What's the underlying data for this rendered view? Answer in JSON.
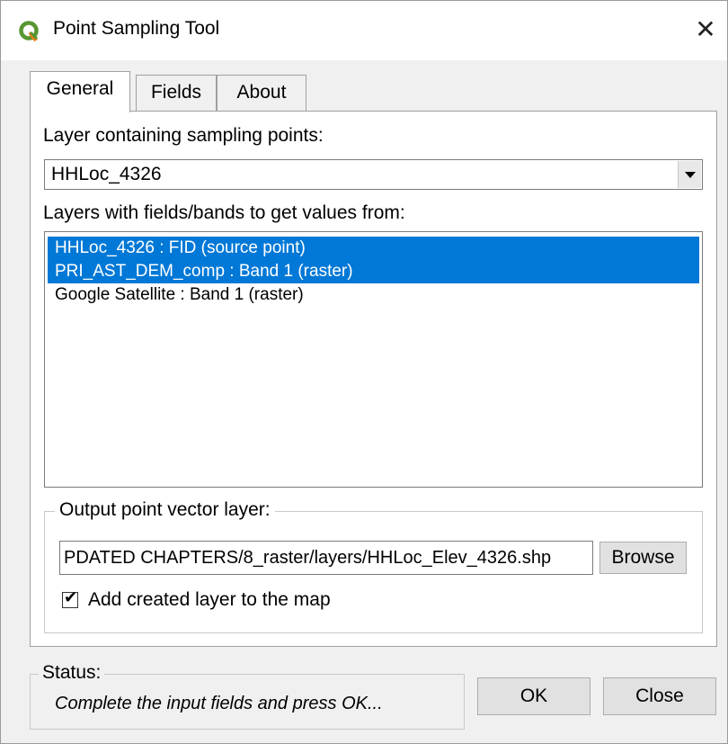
{
  "window": {
    "title": "Point Sampling Tool",
    "close_glyph": "✕"
  },
  "tabs": [
    {
      "label": "General",
      "active": true
    },
    {
      "label": "Fields",
      "active": false
    },
    {
      "label": "About",
      "active": false
    }
  ],
  "general": {
    "sampling_layer_label": "Layer containing sampling points:",
    "sampling_layer_value": "HHLoc_4326",
    "source_layers_label": "Layers with fields/bands to get values from:",
    "source_layers": [
      {
        "label": "HHLoc_4326 : FID (source point)",
        "selected": true
      },
      {
        "label": "PRI_AST_DEM_comp : Band 1 (raster)",
        "selected": true
      },
      {
        "label": "Google Satellite : Band 1 (raster)",
        "selected": false
      }
    ],
    "output": {
      "group_label": "Output point vector layer:",
      "path_value": "PDATED CHAPTERS/8_raster/layers/HHLoc_Elev_4326.shp",
      "browse_label": "Browse",
      "add_to_map_label": "Add created layer to the map",
      "add_to_map_checked": true
    }
  },
  "status": {
    "label": "Status:",
    "message": "Complete the input fields and press OK..."
  },
  "buttons": {
    "ok_label": "OK",
    "close_label": "Close"
  },
  "icons": {
    "app": "qgis-icon",
    "close": "close-icon",
    "dropdown": "chevron-down-icon",
    "check": "checkmark-icon"
  },
  "colors": {
    "selection": "#0078d7",
    "qgis_green": "#589632",
    "qgis_yellow": "#ee7913"
  }
}
